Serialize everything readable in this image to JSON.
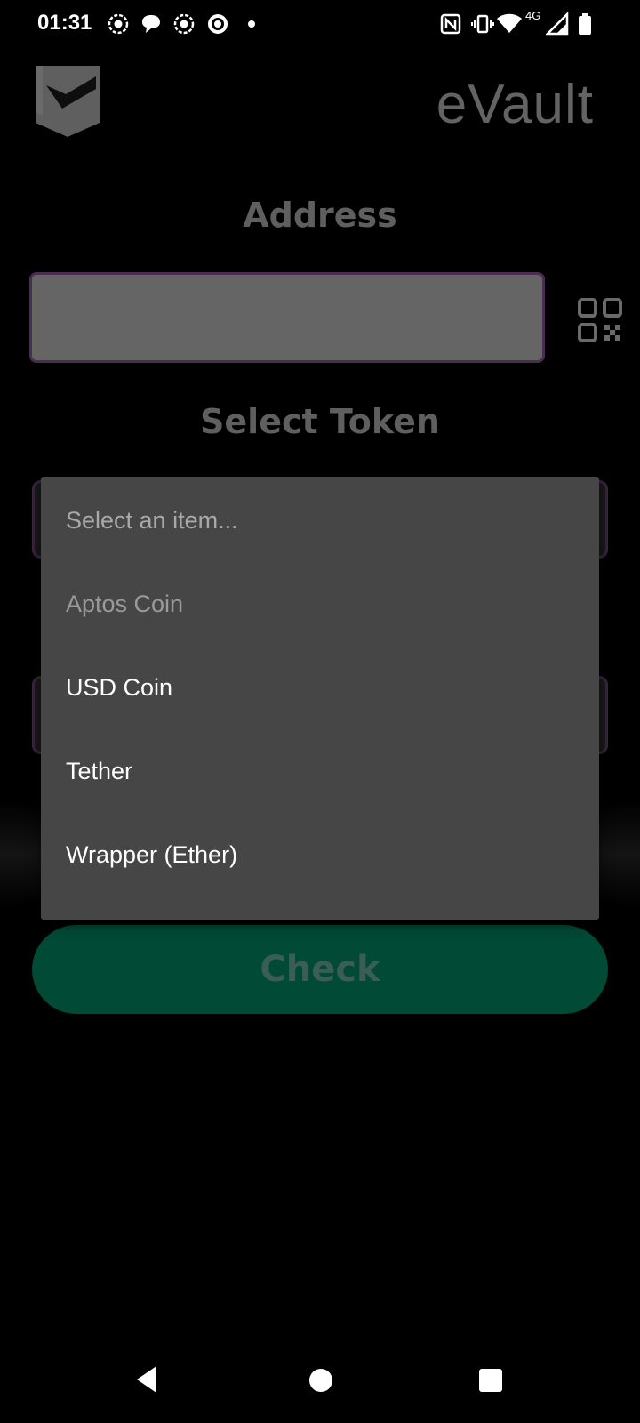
{
  "status_bar": {
    "time": "01:31",
    "network_label": "4G",
    "left_icons": [
      "record-icon",
      "chat-bubble-icon",
      "record-icon",
      "target-icon",
      "dot-icon"
    ],
    "right_icons": [
      "nfc-icon",
      "vibrate-icon",
      "wifi-icon",
      "signal-icon",
      "battery-icon"
    ]
  },
  "header": {
    "brand": "eVault",
    "logo_icon": "shield-logo-icon"
  },
  "address": {
    "title": "Address",
    "value": "",
    "scan_icon": "qr-code-icon"
  },
  "token": {
    "title": "Select Token"
  },
  "dropdown": {
    "items": [
      {
        "label": "Select an item...",
        "state": "placeholder"
      },
      {
        "label": "Aptos Coin",
        "state": "disabled"
      },
      {
        "label": "USD Coin",
        "state": "enabled"
      },
      {
        "label": "Tether",
        "state": "enabled"
      },
      {
        "label": "Wrapper (Ether)",
        "state": "enabled"
      }
    ]
  },
  "actions": {
    "check_label": "Check"
  },
  "colors": {
    "background": "#000000",
    "field_fill": "#656565",
    "field_border": "#4a2d52",
    "dropdown_bg": "#464646",
    "button_bg": "#004a36",
    "button_text": "#3a5e55",
    "brand_text": "#636363"
  },
  "nav": {
    "icons": [
      "back-icon",
      "home-icon",
      "recents-icon"
    ]
  }
}
